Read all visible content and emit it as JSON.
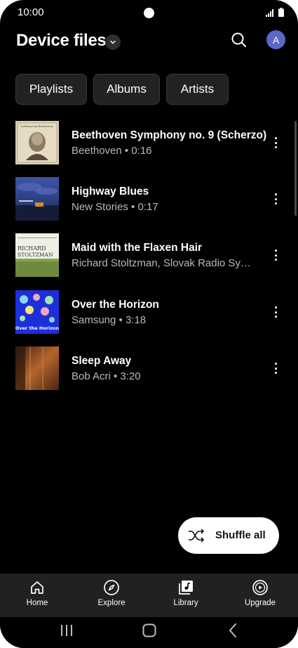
{
  "status_bar": {
    "time": "10:00"
  },
  "header": {
    "title": "Device files",
    "avatar_letter": "A"
  },
  "chips": [
    "Playlists",
    "Albums",
    "Artists"
  ],
  "tracks": [
    {
      "title": "Beethoven Symphony no. 9 (Scherzo)",
      "subtitle": "Beethoven • 0:16"
    },
    {
      "title": "Highway Blues",
      "subtitle": "New Stories • 0:17"
    },
    {
      "title": "Maid with the Flaxen Hair",
      "subtitle": "Richard Stoltzman, Slovak Radio Symphony Orchestra"
    },
    {
      "title": "Over the Horizon",
      "subtitle": "Samsung • 3:18"
    },
    {
      "title": "Sleep Away",
      "subtitle": "Bob Acri • 3:20"
    }
  ],
  "album_art_text": {
    "beethoven": "Ludwig van Beethoven",
    "stoltzman_top": "RICHARD",
    "stoltzman_bottom": "STOLTZMAN",
    "horizon": "Over the Horizon"
  },
  "shuffle": {
    "label": "Shuffle all"
  },
  "bottom_nav": [
    {
      "label": "Home",
      "icon": "home-icon"
    },
    {
      "label": "Explore",
      "icon": "compass-icon"
    },
    {
      "label": "Library",
      "icon": "library-icon"
    },
    {
      "label": "Upgrade",
      "icon": "upgrade-play-icon"
    }
  ],
  "colors": {
    "background": "#000000",
    "avatar": "#5b67c7",
    "nav_bar": "#212121"
  }
}
